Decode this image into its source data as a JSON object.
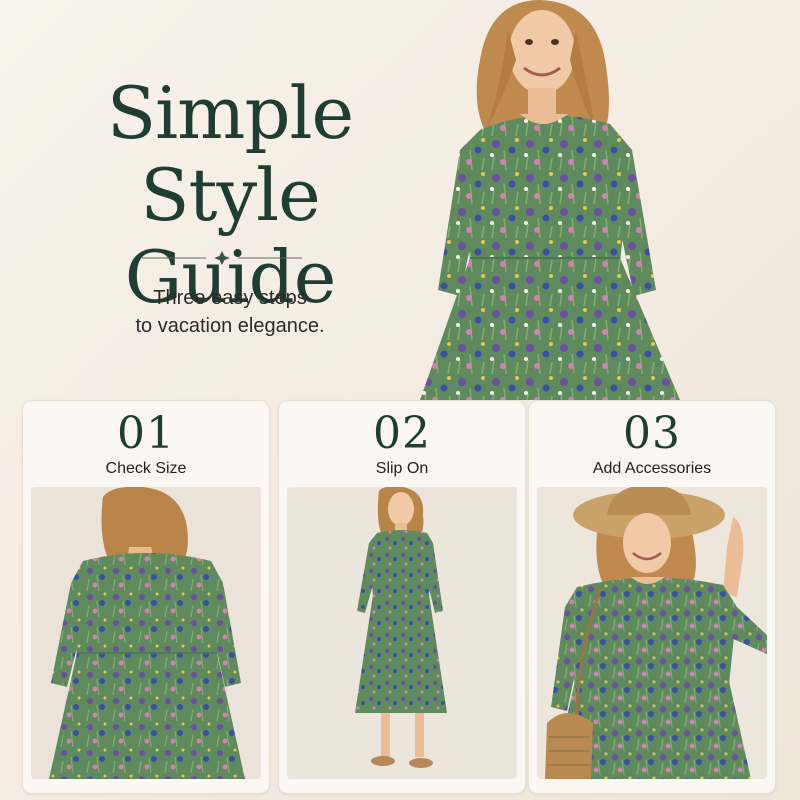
{
  "hero": {
    "title_line1": "Simple",
    "title_line2": "Style Guide",
    "subtitle_line1": "Three easy steps",
    "subtitle_line2": "to vacation elegance."
  },
  "steps": [
    {
      "number": "01",
      "label": "Check Size",
      "photo_icon": "model-back-view-icon"
    },
    {
      "number": "02",
      "label": "Slip On",
      "photo_icon": "model-full-length-icon"
    },
    {
      "number": "03",
      "label": "Add Accessories",
      "photo_icon": "model-hat-bag-icon"
    }
  ],
  "colors": {
    "background": "#f6efe7",
    "title": "#1f3d31",
    "dress_green": "#5f8a5e",
    "hair": "#c08a4e",
    "card_background": "#fbf7f2"
  }
}
